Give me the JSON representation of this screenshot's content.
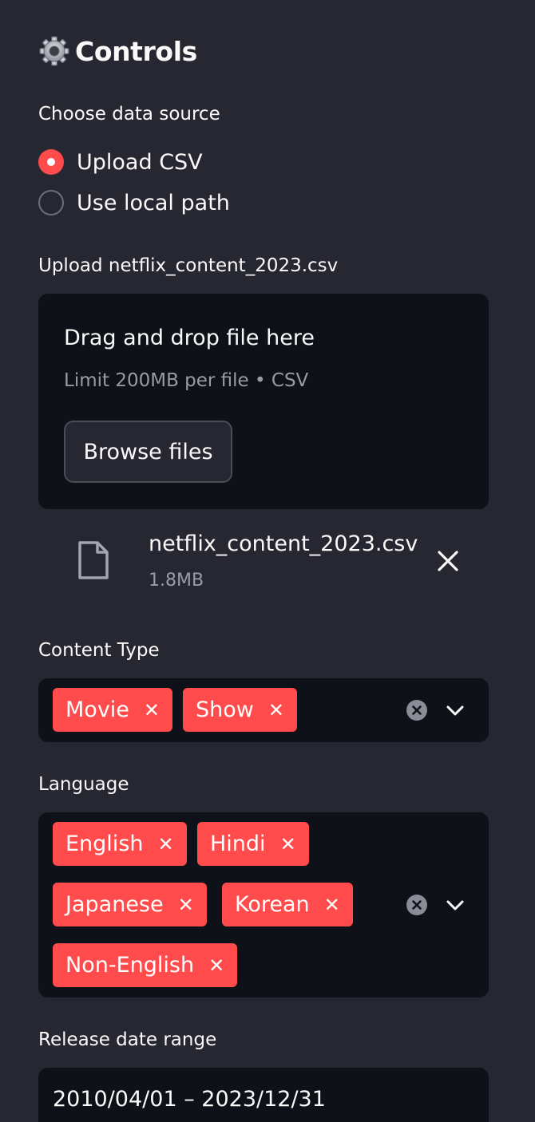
{
  "sidebar": {
    "title": "Controls",
    "title_icon": "gear-icon"
  },
  "data_source": {
    "label": "Choose data source",
    "options": [
      {
        "label": "Upload CSV",
        "selected": true
      },
      {
        "label": "Use local path",
        "selected": false
      }
    ]
  },
  "uploader": {
    "label": "Upload netflix_content_2023.csv",
    "dropzone_title": "Drag and drop file here",
    "limit_text": "Limit 200MB per file • CSV",
    "browse_label": "Browse files",
    "file": {
      "name": "netflix_content_2023.csv",
      "size": "1.8MB",
      "icon": "file-icon",
      "remove_icon": "close-icon"
    }
  },
  "content_type": {
    "label": "Content Type",
    "tags": [
      "Movie",
      "Show"
    ]
  },
  "language": {
    "label": "Language",
    "tags": [
      "English",
      "Hindi",
      "Japanese",
      "Korean",
      "Non-English"
    ]
  },
  "release_date": {
    "label": "Release date range",
    "value": "2010/04/01 – 2023/12/31"
  },
  "colors": {
    "background": "#262730",
    "input_background": "#0e1117",
    "accent": "#ff4b4b",
    "muted_text": "#9a9ca5"
  }
}
